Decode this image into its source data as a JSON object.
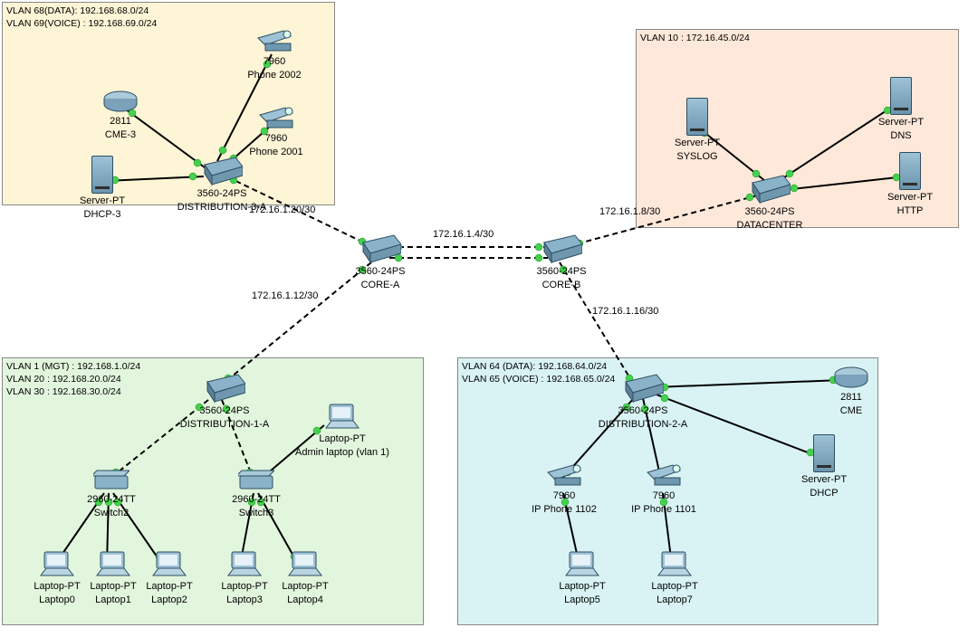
{
  "zones": {
    "dist3": {
      "line1": "VLAN 68(DATA): 192.168.68.0/24",
      "line2": "VLAN 69(VOICE) : 192.168.69.0/24"
    },
    "datacenter": {
      "line1": "VLAN 10 : 172.16.45.0/24"
    },
    "dist1": {
      "line1": "VLAN 1 (MGT) : 192.168.1.0/24",
      "line2": "VLAN 20 : 192.168.20.0/24",
      "line3": "VLAN 30 : 192.168.30.0/24"
    },
    "dist2": {
      "line1": "VLAN 64 (DATA): 192.168.64.0/24",
      "line2": "VLAN 65 (VOICE) : 192.168.65.0/24"
    }
  },
  "labels": {
    "core_a": {
      "l1": "3560-24PS",
      "l2": "CORE-A"
    },
    "core_b": {
      "l1": "3560-24PS",
      "l2": "CORE-B"
    },
    "dist3a": {
      "l1": "3560-24PS",
      "l2": "DISTRIBUTION-3-A"
    },
    "datacen": {
      "l1": "3560-24PS",
      "l2": "DATACENTER"
    },
    "dist1a": {
      "l1": "3560-24PS",
      "l2": "DISTRIBUTION-1-A"
    },
    "dist2a": {
      "l1": "3560-24PS",
      "l2": "DISTRIBUTION-2-A"
    },
    "sw2": {
      "l1": "2960-24TT",
      "l2": "Switch2"
    },
    "sw3": {
      "l1": "2960-24TT",
      "l2": "Switch3"
    },
    "cme3": {
      "l1": "2811",
      "l2": "CME-3"
    },
    "cme": {
      "l1": "2811",
      "l2": "CME"
    },
    "dhcp3": {
      "l1": "Server-PT",
      "l2": "DHCP-3"
    },
    "dhcp": {
      "l1": "Server-PT",
      "l2": "DHCP"
    },
    "syslog": {
      "l1": "Server-PT",
      "l2": "SYSLOG"
    },
    "dns": {
      "l1": "Server-PT",
      "l2": "DNS"
    },
    "http": {
      "l1": "Server-PT",
      "l2": "HTTP"
    },
    "phone2002": {
      "l1": "7960",
      "l2": "Phone 2002"
    },
    "phone2001": {
      "l1": "7960",
      "l2": "Phone 2001"
    },
    "ip1102": {
      "l1": "7960",
      "l2": "IP Phone 1102"
    },
    "ip1101": {
      "l1": "7960",
      "l2": "IP Phone 1101"
    },
    "admin": {
      "l1": "Laptop-PT",
      "l2": "Admin laptop (vlan 1)"
    },
    "lap0": {
      "l1": "Laptop-PT",
      "l2": "Laptop0"
    },
    "lap1": {
      "l1": "Laptop-PT",
      "l2": "Laptop1"
    },
    "lap2": {
      "l1": "Laptop-PT",
      "l2": "Laptop2"
    },
    "lap3": {
      "l1": "Laptop-PT",
      "l2": "Laptop3"
    },
    "lap4": {
      "l1": "Laptop-PT",
      "l2": "Laptop4"
    },
    "lap5": {
      "l1": "Laptop-PT",
      "l2": "Laptop5"
    },
    "lap7": {
      "l1": "Laptop-PT",
      "l2": "Laptop7"
    }
  },
  "link_labels": {
    "l_dist3_core": "172.16.1.20/30",
    "l_core_core": "172.16.1.4/30",
    "l_core_dc": "172.16.1.8/30",
    "l_core_dist1": "172.16.1.12/30",
    "l_core_dist2": "172.16.1.16/30"
  },
  "colors": {
    "zone_dist3": "#fef4d6",
    "zone_datacenter": "#fee8d9",
    "zone_dist1": "#e2f6dd",
    "zone_dist2": "#d9f3f4",
    "device_blue": "#6b94ad"
  }
}
